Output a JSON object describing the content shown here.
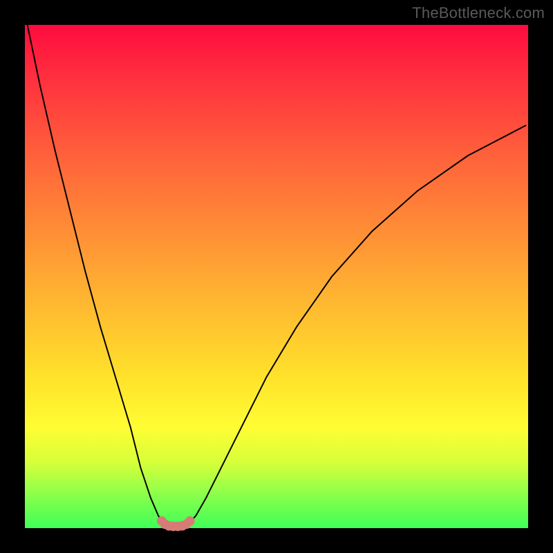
{
  "watermark": "TheBottleneck.com",
  "chart_data": {
    "type": "line",
    "title": "",
    "xlabel": "",
    "ylabel": "",
    "xlim": [
      0,
      100
    ],
    "ylim": [
      0,
      100
    ],
    "grid": false,
    "legend_position": "none",
    "series": [
      {
        "name": "curve-left",
        "stroke": "#000000",
        "x": [
          0.5,
          3,
          6,
          9,
          12,
          15,
          18,
          21,
          23,
          25,
          26.5,
          27.5
        ],
        "y": [
          100,
          88,
          75,
          63,
          51,
          40,
          30,
          20,
          12,
          6,
          2.5,
          0.8
        ]
      },
      {
        "name": "curve-right",
        "stroke": "#000000",
        "x": [
          32.5,
          34,
          36,
          39,
          43,
          48,
          54,
          61,
          69,
          78,
          88,
          99.5
        ],
        "y": [
          0.8,
          2.5,
          6,
          12,
          20,
          30,
          40,
          50,
          59,
          67,
          74,
          80
        ]
      },
      {
        "name": "valley-dots",
        "stroke": "#d77b77",
        "marker": true,
        "x": [
          27.2,
          27.8,
          28.6,
          29.5,
          30.4,
          31.3,
          32.1,
          32.8
        ],
        "y": [
          1.4,
          0.8,
          0.45,
          0.35,
          0.35,
          0.45,
          0.8,
          1.4
        ]
      }
    ],
    "gradient_stops": [
      {
        "offset": 0,
        "color": "#ff0b3f"
      },
      {
        "offset": 10,
        "color": "#ff2e3e"
      },
      {
        "offset": 25,
        "color": "#ff5e3b"
      },
      {
        "offset": 40,
        "color": "#ff8b36"
      },
      {
        "offset": 55,
        "color": "#ffb731"
      },
      {
        "offset": 70,
        "color": "#ffe22a"
      },
      {
        "offset": 80,
        "color": "#fffd33"
      },
      {
        "offset": 87,
        "color": "#d6ff3a"
      },
      {
        "offset": 93,
        "color": "#8fff4a"
      },
      {
        "offset": 100,
        "color": "#3eff58"
      }
    ],
    "valley_center_x": 30
  }
}
